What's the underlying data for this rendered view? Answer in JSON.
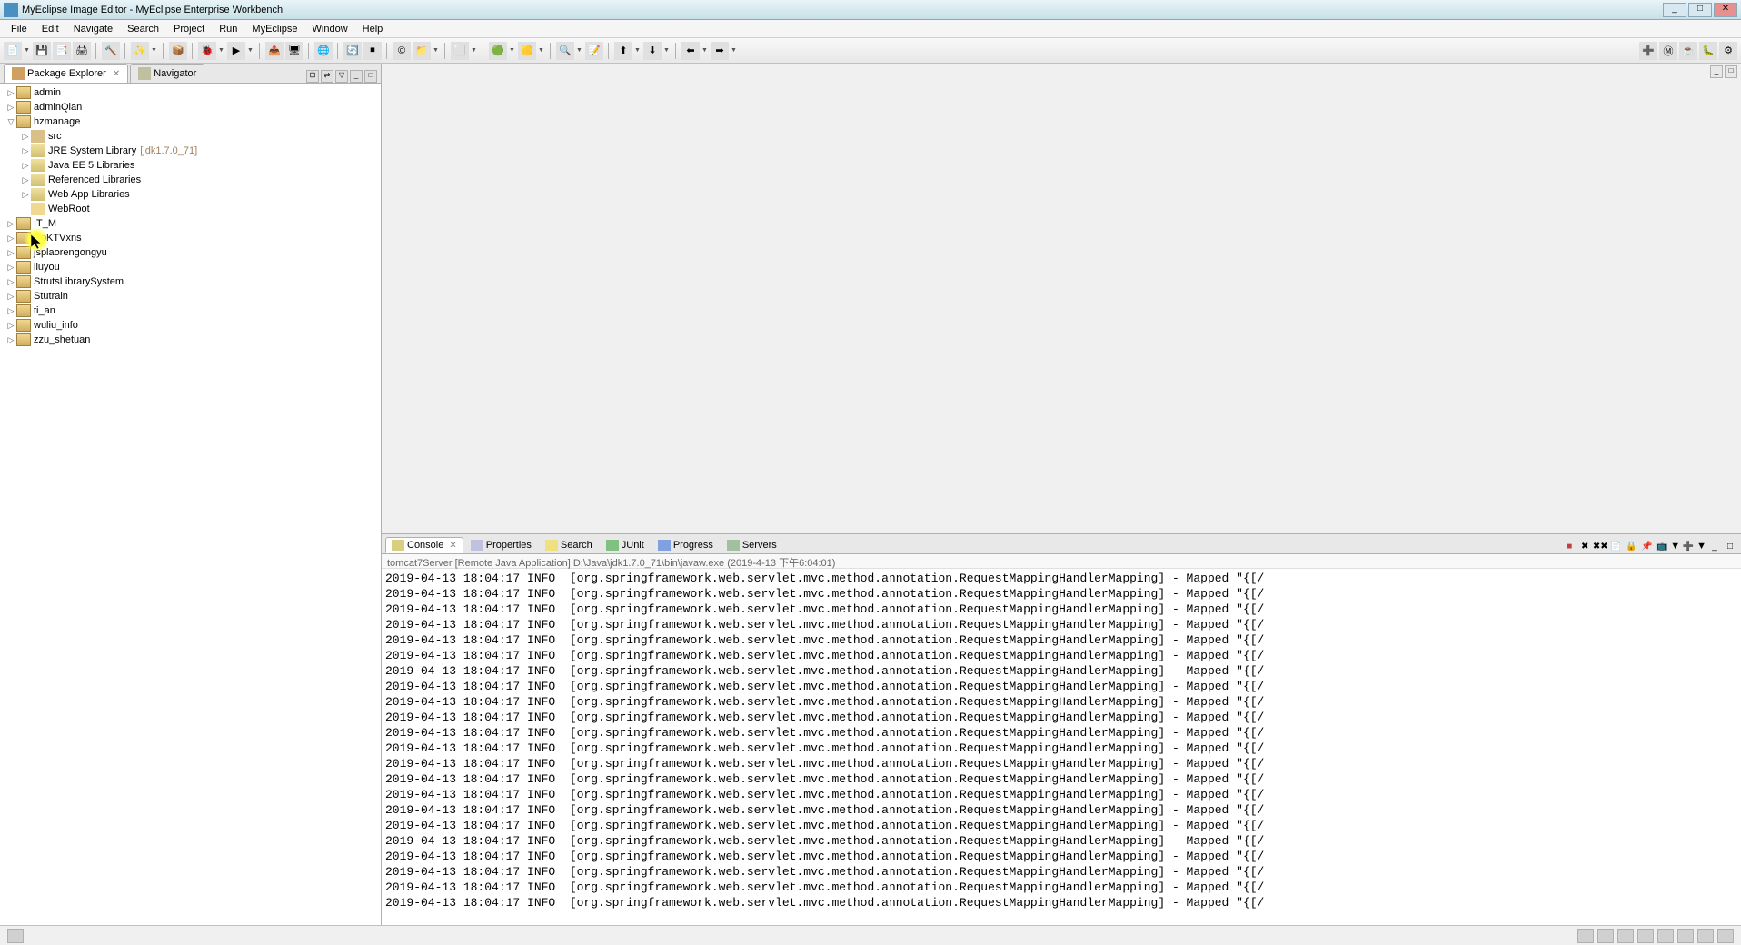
{
  "window": {
    "title": "MyEclipse Image Editor - MyEclipse Enterprise Workbench"
  },
  "menu": {
    "items": [
      "File",
      "Edit",
      "Navigate",
      "Search",
      "Project",
      "Run",
      "MyEclipse",
      "Window",
      "Help"
    ]
  },
  "leftPanel": {
    "tabs": [
      {
        "label": "Package Explorer",
        "active": true,
        "closable": true
      },
      {
        "label": "Navigator",
        "active": false,
        "closable": false
      }
    ]
  },
  "tree": [
    {
      "lvl": 0,
      "exp": "▷",
      "icon": "proj",
      "label": "admin"
    },
    {
      "lvl": 0,
      "exp": "▷",
      "icon": "proj",
      "label": "adminQian"
    },
    {
      "lvl": 0,
      "exp": "▽",
      "icon": "proj",
      "label": "hzmanage"
    },
    {
      "lvl": 1,
      "exp": "▷",
      "icon": "src",
      "label": "src"
    },
    {
      "lvl": 1,
      "exp": "▷",
      "icon": "lib",
      "label": "JRE System Library",
      "decoration": "[jdk1.7.0_71]"
    },
    {
      "lvl": 1,
      "exp": "▷",
      "icon": "lib",
      "label": "Java EE 5 Libraries"
    },
    {
      "lvl": 1,
      "exp": "▷",
      "icon": "lib",
      "label": "Referenced Libraries"
    },
    {
      "lvl": 1,
      "exp": "▷",
      "icon": "lib",
      "label": "Web App Libraries"
    },
    {
      "lvl": 1,
      "exp": "",
      "icon": "folder",
      "label": "WebRoot"
    },
    {
      "lvl": 0,
      "exp": "▷",
      "icon": "proj",
      "label": "IT_M"
    },
    {
      "lvl": 0,
      "exp": "▷",
      "icon": "proj",
      "label": "jspKTVxns"
    },
    {
      "lvl": 0,
      "exp": "▷",
      "icon": "proj",
      "label": "jsplaorengongyu"
    },
    {
      "lvl": 0,
      "exp": "▷",
      "icon": "proj",
      "label": "liuyou"
    },
    {
      "lvl": 0,
      "exp": "▷",
      "icon": "proj",
      "label": "StrutsLibrarySystem"
    },
    {
      "lvl": 0,
      "exp": "▷",
      "icon": "proj",
      "label": "Stutrain"
    },
    {
      "lvl": 0,
      "exp": "▷",
      "icon": "proj",
      "label": "ti_an"
    },
    {
      "lvl": 0,
      "exp": "▷",
      "icon": "proj",
      "label": "wuliu_info"
    },
    {
      "lvl": 0,
      "exp": "▷",
      "icon": "proj",
      "label": "zzu_shetuan"
    }
  ],
  "bottomPanel": {
    "tabs": [
      {
        "label": "Console",
        "iconCls": "console",
        "active": true,
        "closable": true
      },
      {
        "label": "Properties",
        "iconCls": "props",
        "active": false
      },
      {
        "label": "Search",
        "iconCls": "search",
        "active": false
      },
      {
        "label": "JUnit",
        "iconCls": "junit",
        "active": false,
        "prefix": "JU "
      },
      {
        "label": "Progress",
        "iconCls": "progress",
        "active": false
      },
      {
        "label": "Servers",
        "iconCls": "servers",
        "active": false
      }
    ],
    "info": "tomcat7Server [Remote Java Application] D:\\Java\\jdk1.7.0_71\\bin\\javaw.exe (2019-4-13 下午6:04:01)"
  },
  "console": {
    "line": "2019-04-13 18:04:17 INFO  [org.springframework.web.servlet.mvc.method.annotation.RequestMappingHandlerMapping] - Mapped \"{[/",
    "repeat": 22
  }
}
